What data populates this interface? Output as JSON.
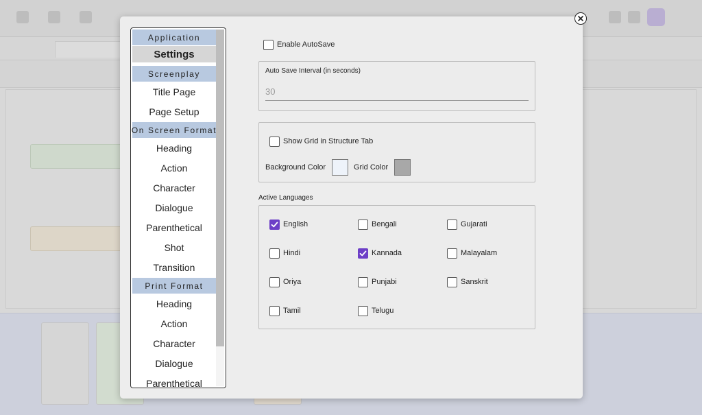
{
  "sidebar": {
    "sections": [
      {
        "header": "Application",
        "items": [
          {
            "label": "Settings",
            "active": true
          }
        ]
      },
      {
        "header": "Screenplay",
        "items": [
          {
            "label": "Title Page"
          },
          {
            "label": "Page Setup"
          }
        ]
      },
      {
        "header": "On Screen Format",
        "items": [
          {
            "label": "Heading"
          },
          {
            "label": "Action"
          },
          {
            "label": "Character"
          },
          {
            "label": "Dialogue"
          },
          {
            "label": "Parenthetical"
          },
          {
            "label": "Shot"
          },
          {
            "label": "Transition"
          }
        ]
      },
      {
        "header": "Print Format",
        "items": [
          {
            "label": "Heading"
          },
          {
            "label": "Action"
          },
          {
            "label": "Character"
          },
          {
            "label": "Dialogue"
          },
          {
            "label": "Parenthetical"
          }
        ]
      }
    ]
  },
  "settings": {
    "autosave_label": "Enable AutoSave",
    "autosave_checked": false,
    "interval_label": "Auto Save Interval (in seconds)",
    "interval_placeholder": "30",
    "show_grid_label": "Show Grid in Structure Tab",
    "show_grid_checked": false,
    "background_color_label": "Background Color",
    "background_color": "#eef3fa",
    "grid_color_label": "Grid Color",
    "grid_color": "#a8a8a8"
  },
  "languages": {
    "title": "Active Languages",
    "items": [
      {
        "label": "English",
        "checked": true
      },
      {
        "label": "Bengali",
        "checked": false
      },
      {
        "label": "Gujarati",
        "checked": false
      },
      {
        "label": "Hindi",
        "checked": false
      },
      {
        "label": "Kannada",
        "checked": true
      },
      {
        "label": "Malayalam",
        "checked": false
      },
      {
        "label": "Oriya",
        "checked": false
      },
      {
        "label": "Punjabi",
        "checked": false
      },
      {
        "label": "Sanskrit",
        "checked": false
      },
      {
        "label": "Tamil",
        "checked": false
      },
      {
        "label": "Telugu",
        "checked": false
      }
    ]
  },
  "colors": {
    "accent": "#6d3fc7",
    "section_header": "#b8c9e0",
    "active_item": "#d6d6d6"
  }
}
